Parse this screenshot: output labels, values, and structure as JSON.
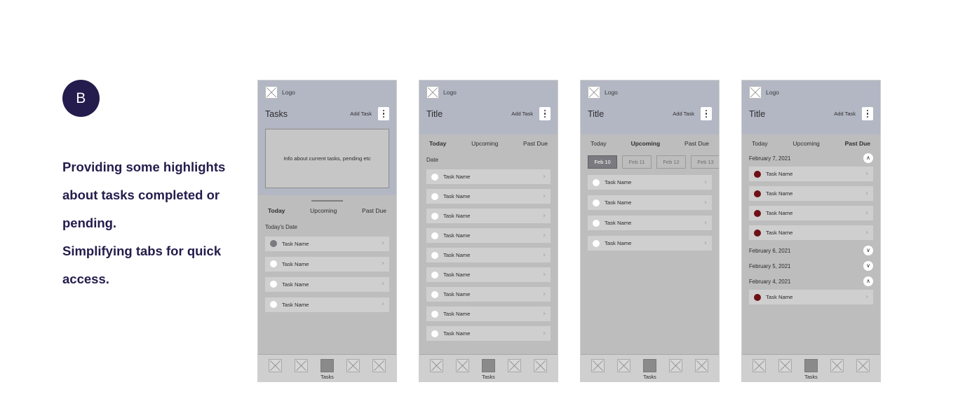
{
  "annotation": {
    "avatar_initial": "B",
    "avatar_color": "#241c4c",
    "text": "Providing some highlights about tasks completed or pending. Simplifying tabs for quick access.",
    "line1": "Providing some highlights",
    "line2": "about tasks completed or",
    "line3": "pending.",
    "line4": "Simplifying tabs for quick",
    "line5": "access."
  },
  "common": {
    "logo_label": "Logo",
    "logo_icon": "placeholder-x-icon",
    "add_task_label": "Add Task",
    "kebab_icon": "more-vertical-icon",
    "chevron_right_icon": "›",
    "chevron_up_icon": "∧",
    "chevron_down_icon": "∨",
    "task_name": "Task Name",
    "bottom_nav": {
      "items": [
        {
          "icon": "placeholder-x-icon",
          "label": "",
          "active": false
        },
        {
          "icon": "placeholder-x-icon",
          "label": "",
          "active": false
        },
        {
          "icon": "placeholder-x-icon",
          "label": "Tasks",
          "active": true
        },
        {
          "icon": "placeholder-x-icon",
          "label": "",
          "active": false
        },
        {
          "icon": "placeholder-x-icon",
          "label": "",
          "active": false
        }
      ]
    },
    "tab_labels": [
      "Today",
      "Upcoming",
      "Past Due"
    ],
    "colors": {
      "header_band": "#b3b7c4",
      "body": "#bdbdbd",
      "task_row": "#cfcfcf",
      "overdue_dot": "#6e1016",
      "filled_dot": "#7a7a7f",
      "chip_selected": "#7a7a80"
    }
  },
  "phones": [
    {
      "id": "phone-1",
      "title": "Tasks",
      "info_box_text": "Info about current tasks, pending etc",
      "active_tab": "Today",
      "section_label": "Today's Date",
      "tasks": [
        {
          "name": "Task Name",
          "dot": "filled"
        },
        {
          "name": "Task Name",
          "dot": "empty"
        },
        {
          "name": "Task Name",
          "dot": "empty"
        },
        {
          "name": "Task Name",
          "dot": "empty"
        }
      ]
    },
    {
      "id": "phone-2",
      "title": "Title",
      "active_tab": "Today",
      "section_label": "Date",
      "tasks": [
        {
          "name": "Task Name",
          "dot": "empty"
        },
        {
          "name": "Task Name",
          "dot": "empty"
        },
        {
          "name": "Task Name",
          "dot": "empty"
        },
        {
          "name": "Task Name",
          "dot": "empty"
        },
        {
          "name": "Task Name",
          "dot": "empty"
        },
        {
          "name": "Task Name",
          "dot": "empty"
        },
        {
          "name": "Task Name",
          "dot": "empty"
        },
        {
          "name": "Task Name",
          "dot": "empty"
        },
        {
          "name": "Task Name",
          "dot": "empty"
        }
      ]
    },
    {
      "id": "phone-3",
      "title": "Title",
      "active_tab": "Upcoming",
      "date_chips": [
        {
          "label": "Feb 10",
          "selected": true
        },
        {
          "label": "Feb 11",
          "selected": false
        },
        {
          "label": "Feb 12",
          "selected": false
        },
        {
          "label": "Feb 13",
          "selected": false
        }
      ],
      "tasks": [
        {
          "name": "Task Name",
          "dot": "empty"
        },
        {
          "name": "Task Name",
          "dot": "empty"
        },
        {
          "name": "Task Name",
          "dot": "empty"
        },
        {
          "name": "Task Name",
          "dot": "empty"
        }
      ]
    },
    {
      "id": "phone-4",
      "title": "Title",
      "active_tab": "Past Due",
      "groups": [
        {
          "date": "February 7, 2021",
          "expanded": true,
          "tasks": [
            {
              "name": "Task Name",
              "dot": "overdue"
            },
            {
              "name": "Task Name",
              "dot": "overdue"
            },
            {
              "name": "Task Name",
              "dot": "overdue"
            },
            {
              "name": "Task Name",
              "dot": "overdue"
            }
          ]
        },
        {
          "date": "February 6, 2021",
          "expanded": false,
          "tasks": []
        },
        {
          "date": "February 5, 2021",
          "expanded": false,
          "tasks": []
        },
        {
          "date": "February 4, 2021",
          "expanded": true,
          "tasks": [
            {
              "name": "Task Name",
              "dot": "overdue"
            }
          ]
        }
      ]
    }
  ]
}
